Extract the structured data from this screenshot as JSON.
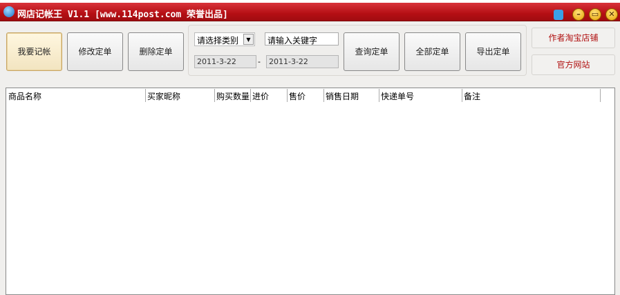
{
  "title": "网店记帐王 V1.1 [www.114post.com 荣誉出品]",
  "buttons": {
    "add": "我要记帐",
    "edit": "修改定单",
    "delete": "删除定单",
    "query": "查询定单",
    "all": "全部定单",
    "export": "导出定单"
  },
  "filter": {
    "category": "请选择类别",
    "keyword": "请输入关键字",
    "date_from": "2011-3-22",
    "date_sep": "-",
    "date_to": "2011-3-22"
  },
  "links": {
    "shop": "作者淘宝店铺",
    "site": "官方网站"
  },
  "table": {
    "columns": [
      "商品名称",
      "买家昵称",
      "购买数量",
      "进价",
      "售价",
      "销售日期",
      "快递单号",
      "备注"
    ]
  },
  "icons": {
    "minimize": "–",
    "maximize": "▭",
    "close": "✕"
  }
}
